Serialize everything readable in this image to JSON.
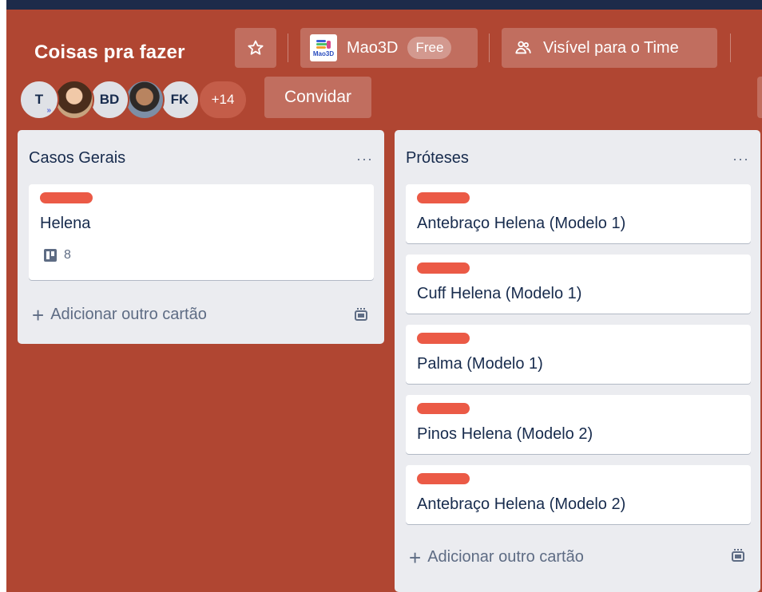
{
  "board": {
    "title": "Coisas pra fazer",
    "workspace_name": "Mao3D",
    "workspace_logo_text": "Mao3D",
    "plan_badge": "Free",
    "visibility_label": "Visível para o Time",
    "invite_label": "Convidar",
    "background_color": "#b04632"
  },
  "members": [
    {
      "initials": "T",
      "admin": true
    },
    {
      "initials": "",
      "photo": true
    },
    {
      "initials": "BD"
    },
    {
      "initials": "",
      "photo": true
    },
    {
      "initials": "FK"
    },
    {
      "initials": "+14",
      "overflow": true
    }
  ],
  "admin_mark": "»",
  "lists": [
    {
      "title": "Casos Gerais",
      "menu": "···",
      "cards": [
        {
          "title": "Helena",
          "label_color": "#eb5a46",
          "checklist_count": "8"
        }
      ],
      "add_card_label": "Adicionar outro cartão"
    },
    {
      "title": "Próteses",
      "menu": "···",
      "cards": [
        {
          "title": "Antebraço Helena (Modelo 1)",
          "label_color": "#eb5a46"
        },
        {
          "title": "Cuff Helena (Modelo 1)",
          "label_color": "#eb5a46"
        },
        {
          "title": "Palma (Modelo 1)",
          "label_color": "#eb5a46"
        },
        {
          "title": "Pinos Helena (Modelo 2)",
          "label_color": "#eb5a46"
        },
        {
          "title": "Antebraço Helena (Modelo 2)",
          "label_color": "#eb5a46"
        }
      ],
      "add_card_label": "Adicionar outro cartão"
    }
  ],
  "icons": {
    "star": "star-icon",
    "visibility": "team-visibility-icon",
    "add": "plus-icon",
    "template": "card-template-icon",
    "board_badge": "board-icon"
  }
}
